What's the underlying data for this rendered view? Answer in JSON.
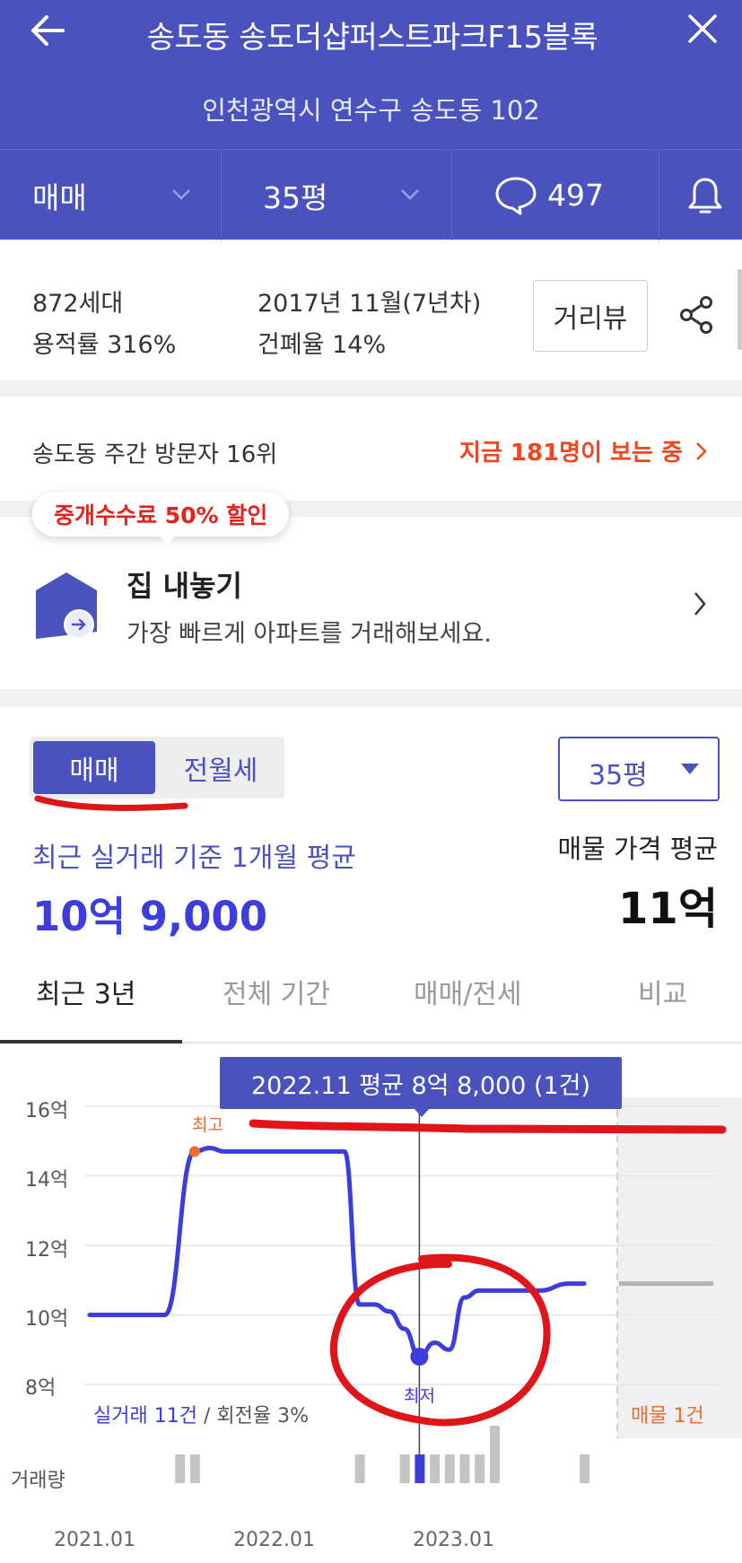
{
  "header": {
    "title": "송도동 송도더샵퍼스트파크F15블록",
    "address": "인천광역시 연수구 송도동 102",
    "deal_type": "매매",
    "size": "35평",
    "comment_count": "497"
  },
  "info": {
    "households": "872세대",
    "floor_area_ratio": "용적률 316%",
    "built": "2017년 11월(7년차)",
    "coverage_ratio": "건폐율 14%",
    "street_view_label": "거리뷰"
  },
  "visitors": {
    "rank_text": "송도동 주간 방문자 16위",
    "now_viewing": "지금 181명이 보는 중"
  },
  "listing": {
    "badge": "중개수수료 50% 할인",
    "title": "집 내놓기",
    "subtitle": "가장 빠르게 아파트를 거래해보세요."
  },
  "price": {
    "toggle_sale": "매매",
    "toggle_rent": "전월세",
    "size_select": "35평",
    "recent_label": "최근 실거래 기준 1개월 평균",
    "recent_value": "10억 9,000",
    "listing_label": "매물 가격 평균",
    "listing_value": "11억"
  },
  "tabs": [
    "최근 3년",
    "전체 기간",
    "매매/전세",
    "비교"
  ],
  "chart_data": {
    "type": "line",
    "tooltip": "2022.11 평균 8억 8,000 (1건)",
    "yticks": [
      "16억",
      "14억",
      "12억",
      "10억",
      "8억"
    ],
    "ylim": [
      8,
      16
    ],
    "xticks": [
      "2021.01",
      "2022.01",
      "2023.01"
    ],
    "max_label": "최고",
    "min_label": "최저",
    "trade_count_label": "실거래 11건",
    "turnover_label": "회전율 3%",
    "listing_count_label": "매물 1건",
    "volume_label": "거래량",
    "series": [
      {
        "x": [
          "2021.01",
          "2021.06",
          "2021.08",
          "2021.09",
          "2021.10",
          "2022.06",
          "2022.07",
          "2022.08",
          "2022.09",
          "2022.10",
          "2022.11",
          "2022.12",
          "2023.01",
          "2023.02",
          "2023.03",
          "2023.04",
          "2023.07",
          "2023.09",
          "2023.10"
        ],
        "values": [
          10.0,
          10.0,
          14.7,
          14.8,
          14.7,
          14.7,
          10.3,
          10.3,
          10.1,
          9.6,
          8.8,
          9.2,
          9.0,
          10.5,
          10.7,
          10.7,
          10.7,
          10.9,
          10.9
        ]
      }
    ],
    "listing_price": 10.9,
    "max": {
      "x": "2021.08",
      "value": 14.7
    },
    "min": {
      "x": "2022.11",
      "value": 8.8
    },
    "volume": [
      {
        "x": "2021.07",
        "count": 1
      },
      {
        "x": "2021.08",
        "count": 1
      },
      {
        "x": "2022.07",
        "count": 1
      },
      {
        "x": "2022.10",
        "count": 1
      },
      {
        "x": "2022.11",
        "count": 1
      },
      {
        "x": "2022.12",
        "count": 1
      },
      {
        "x": "2023.01",
        "count": 1
      },
      {
        "x": "2023.02",
        "count": 1
      },
      {
        "x": "2023.03",
        "count": 1
      },
      {
        "x": "2023.04",
        "count": 2
      },
      {
        "x": "2023.10",
        "count": 1
      }
    ],
    "colors": {
      "line": "#3D3DDC",
      "max": "#F26A2E",
      "accent": "#4A52BE",
      "red_mark": "#E0151A"
    }
  }
}
